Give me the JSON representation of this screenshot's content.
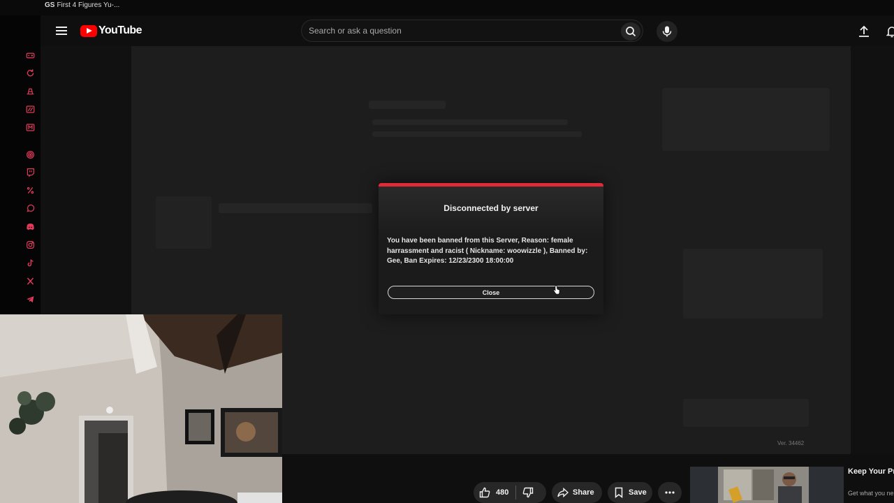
{
  "tab": {
    "prefix": "GS",
    "title": "First 4 Figures Yu-..."
  },
  "header": {
    "logo_text": "YouTube",
    "search_placeholder": "Search or ask a question"
  },
  "sidebar_icons": [
    "gamepad-icon",
    "refresh-icon",
    "hat-icon",
    "slash-box-icon",
    "m-box-icon",
    "target-icon",
    "twitch-icon",
    "percent-icon",
    "whatsapp-icon",
    "discord-icon",
    "instagram-icon",
    "tiktok-icon",
    "x-icon",
    "telegram-icon"
  ],
  "dialog": {
    "title": "Disconnected by server",
    "message": "You have been banned from this Server, Reason: female harrassment and racist ( Nickname: woowizzle ), Banned by: Gee, Ban Expires: 12/23/2300 18:00:00",
    "close_label": "Close",
    "accent_color": "#e02a38"
  },
  "player": {
    "version": "Ver. 34462"
  },
  "actions": {
    "like_count": "480",
    "share_label": "Share",
    "save_label": "Save"
  },
  "ad": {
    "title": "Keep Your Pro Moving Forwa",
    "subtitle": "Get what you ne Grainger with ea"
  }
}
